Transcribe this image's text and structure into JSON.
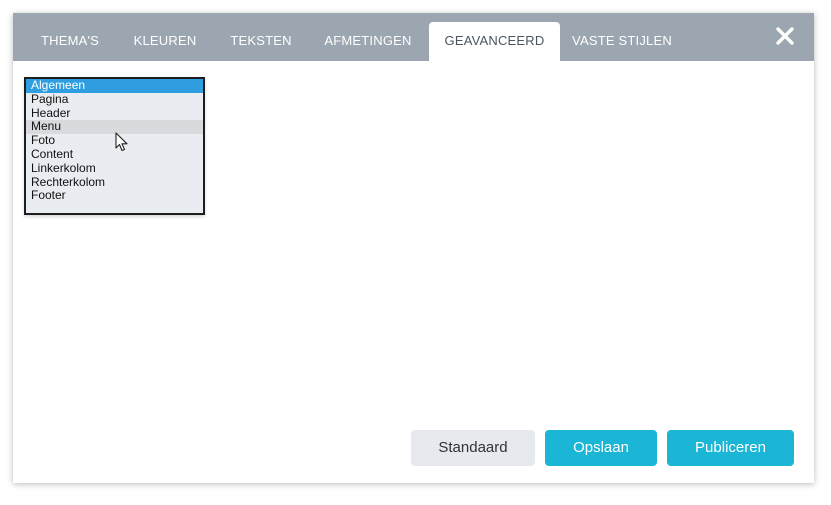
{
  "tabs": [
    {
      "label": "THEMA'S",
      "active": false
    },
    {
      "label": "KLEUREN",
      "active": false
    },
    {
      "label": "TEKSTEN",
      "active": false
    },
    {
      "label": "AFMETINGEN",
      "active": false
    },
    {
      "label": "GEAVANCEERD",
      "active": true
    },
    {
      "label": "VASTE STIJLEN",
      "active": false
    }
  ],
  "close_icon": "close-icon",
  "list": {
    "options": [
      "Algemeen",
      "Pagina",
      "Header",
      "Menu",
      "Foto",
      "Content",
      "Linkerkolom",
      "Rechterkolom",
      "Footer"
    ],
    "selected": "Algemeen",
    "hovered": "Menu"
  },
  "buttons": {
    "standaard": "Standaard",
    "opslaan": "Opslaan",
    "publiceren": "Publiceren"
  },
  "colors": {
    "tabbar": "#9ba6b1",
    "accent": "#1bb5d5",
    "selection": "#2f9ee0"
  }
}
